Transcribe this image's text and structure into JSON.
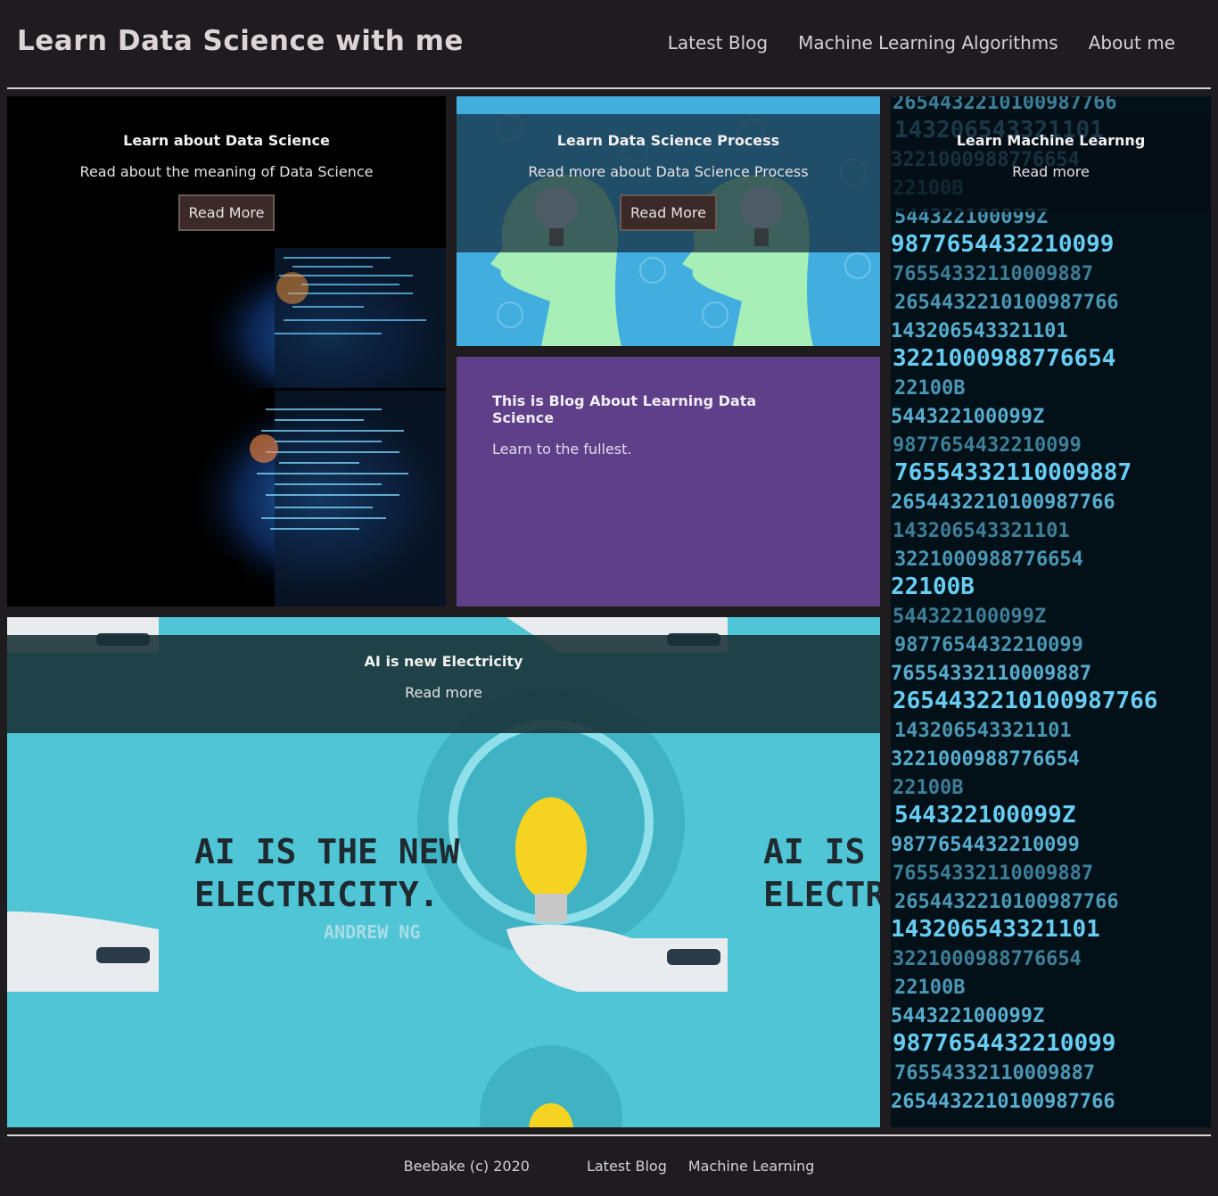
{
  "header": {
    "title": "Learn Data Science with me",
    "nav": [
      "Latest Blog",
      "Machine Learning Algorithms",
      "About me"
    ]
  },
  "cards": {
    "data_science": {
      "title": "Learn about Data Science",
      "text": "Read about the meaning of Data Science",
      "button": "Read More"
    },
    "process": {
      "title": "Learn Data Science Process",
      "text": "Read more about Data Science Process",
      "button": "Read More"
    },
    "blog": {
      "title": "This is Blog About Learning Data Science",
      "text": "Learn to the fullest."
    },
    "ml": {
      "title": "Learn Machine Learnng",
      "text": "Read more"
    },
    "ai": {
      "title": "AI is new Electricity",
      "text": "Read more"
    }
  },
  "ai_image": {
    "quote_line1": "AI IS THE NEW",
    "quote_line2": "ELECTRICITY.",
    "quote_author": "ANDREW NG",
    "partial_line1": "AI IS T",
    "partial_line2": "ELECTR"
  },
  "ml_image": {
    "digits": [
      "2654432210100987766",
      "143206543321101",
      "3221000988776654",
      "22100B",
      "544322100099Z",
      "9877654432210099",
      "76554332110009887"
    ]
  },
  "footer": {
    "copyright": "Beebake (c) 2020",
    "links": [
      "Latest Blog",
      "Machine Learning"
    ]
  },
  "colors": {
    "background": "#1e1c1f",
    "purple_card": "#5e3f88",
    "button_bg": "#3b2a27",
    "ai_cyan": "#4fc5d6"
  }
}
